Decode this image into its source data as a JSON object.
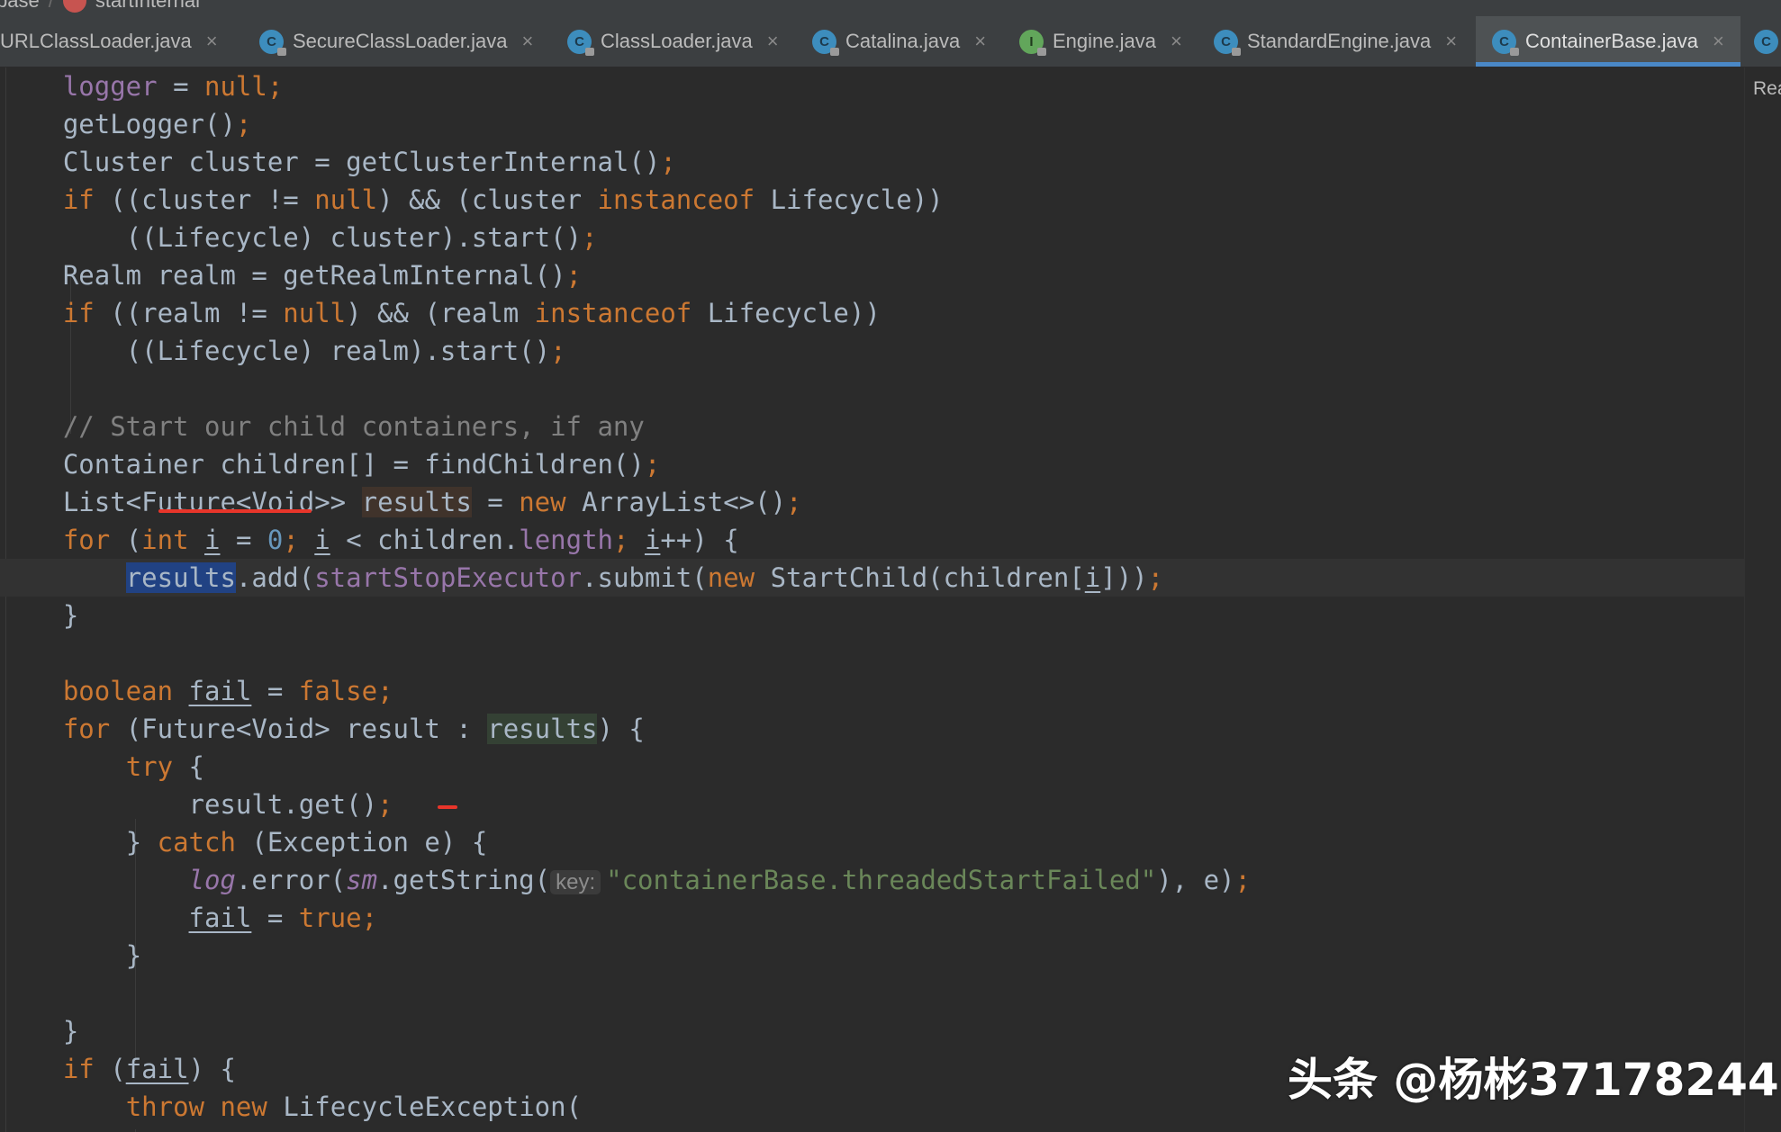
{
  "breadcrumb": {
    "part1": "base",
    "part2": "startInternal"
  },
  "tabs": [
    {
      "label": "URLClassLoader.java",
      "kind": "C"
    },
    {
      "label": "SecureClassLoader.java",
      "kind": "C"
    },
    {
      "label": "ClassLoader.java",
      "kind": "C"
    },
    {
      "label": "Catalina.java",
      "kind": "C"
    },
    {
      "label": "Engine.java",
      "kind": "I"
    },
    {
      "label": "StandardEngine.java",
      "kind": "C"
    },
    {
      "label": "ContainerBase.java",
      "kind": "C",
      "active": true
    }
  ],
  "right_panel": {
    "label": "Rea"
  },
  "code": {
    "l1": [
      "logger",
      "=",
      "null",
      "getLogger()"
    ],
    "l3": [
      "Cluster cluster = getClusterInternal()"
    ],
    "l4": [
      "if",
      "((cluster != ",
      "null",
      ") && (cluster ",
      "instanceof",
      " Lifecycle))"
    ],
    "l5": [
      "((Lifecycle) cluster).start()"
    ],
    "l6": [
      "Realm realm = getRealmInternal()"
    ],
    "l7": [
      "if",
      "((realm != ",
      "null",
      ") && (realm ",
      "instanceof",
      " Lifecycle))"
    ],
    "l8": [
      "((Lifecycle) realm).start()"
    ],
    "l10": [
      "// Start our child containers, if any"
    ],
    "l11": [
      "Container children[] = findChildren()"
    ],
    "l12": [
      "List<",
      "Future<Void",
      ">> ",
      "results",
      " = ",
      "new",
      " ArrayList<>()"
    ],
    "l13": [
      "for",
      " (",
      "int",
      " ",
      "i",
      " = ",
      "0",
      "; ",
      "i",
      " < children.",
      "length",
      "; ",
      "i",
      "++) {"
    ],
    "l14": [
      "results",
      ".add(",
      "startStopExecutor",
      ".submit(",
      "new",
      " StartChild(children[",
      "i",
      "]))"
    ],
    "l15": [
      "}"
    ],
    "l17": [
      "boolean",
      " ",
      "fail",
      " = ",
      "false"
    ],
    "l18": [
      "for",
      " (Future<Void> result : ",
      "results",
      ") {"
    ],
    "l19": [
      "try",
      " {"
    ],
    "l20": [
      "result.get()"
    ],
    "l21": [
      "} ",
      "catch",
      " (Exception e) {"
    ],
    "l22": [
      "log",
      ".error(",
      "sm",
      ".getString(",
      "key:",
      "\"containerBase.threadedStartFailed\"",
      "), e)"
    ],
    "l23": [
      "fail",
      " = ",
      "true"
    ],
    "l24": [
      "}"
    ],
    "l26": [
      "}"
    ],
    "l27": [
      "if",
      " (",
      "fail",
      ") {"
    ],
    "l28": [
      "throw",
      " ",
      "new",
      " LifecycleException("
    ]
  },
  "watermark": "头条 @杨彬37178244"
}
